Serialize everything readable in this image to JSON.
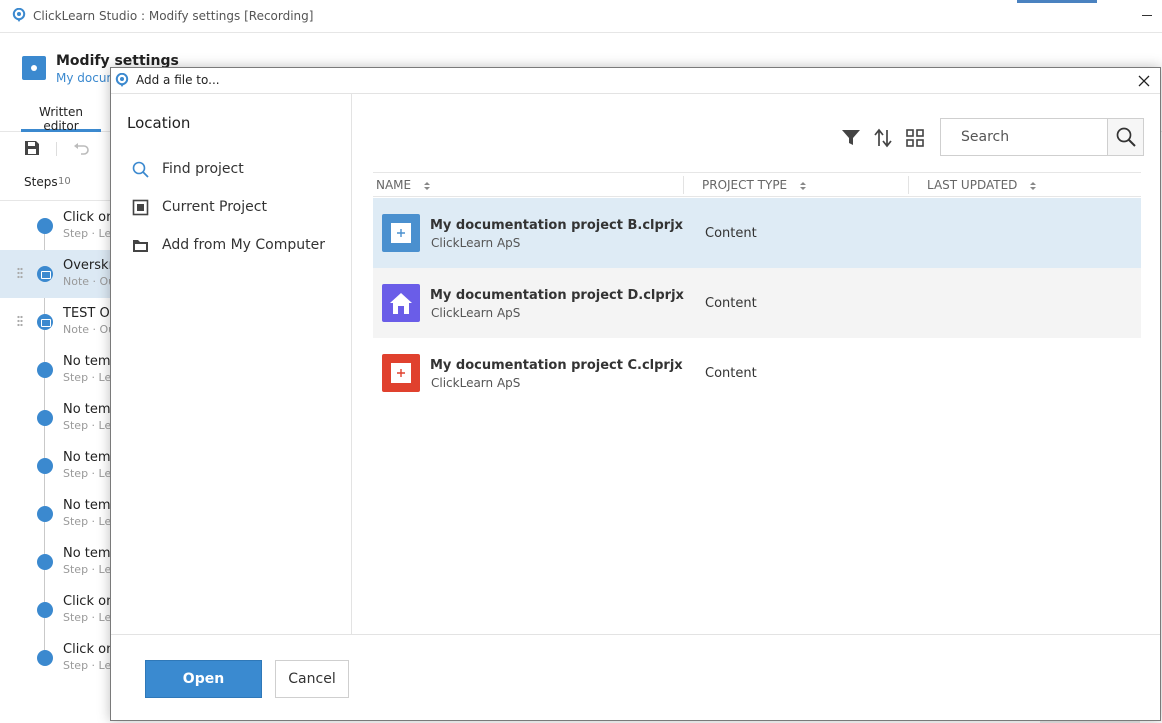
{
  "app": {
    "window_title": "ClickLearn Studio : Modify settings [Recording]",
    "heading": "Modify settings",
    "subheading": "My docum",
    "tab_label": "Written editor",
    "steps_label": "Steps",
    "steps_count": "10",
    "steps": [
      {
        "title": "Click on",
        "meta": "Step · Le",
        "kind": "step",
        "selected": false
      },
      {
        "title": "Overskr",
        "meta": "Note · Ou",
        "kind": "note",
        "selected": true
      },
      {
        "title": "TEST Op",
        "meta": "Note · Ou",
        "kind": "note",
        "selected": false
      },
      {
        "title": "No temp",
        "meta": "Step · Le",
        "kind": "step",
        "selected": false
      },
      {
        "title": "No temp",
        "meta": "Step · Le",
        "kind": "step",
        "selected": false
      },
      {
        "title": "No temp",
        "meta": "Step · Le",
        "kind": "step",
        "selected": false
      },
      {
        "title": "No temp",
        "meta": "Step · Le",
        "kind": "step",
        "selected": false
      },
      {
        "title": "No temp",
        "meta": "Step · Le",
        "kind": "step",
        "selected": false
      },
      {
        "title": "Click on",
        "meta": "Step · Le",
        "kind": "step",
        "selected": false
      },
      {
        "title": "Click on",
        "meta": "Step · Le",
        "kind": "step",
        "selected": false
      }
    ]
  },
  "dialog": {
    "title": "Add a file to...",
    "location_heading": "Location",
    "locations": [
      {
        "label": "Find project",
        "icon": "search-icon",
        "active": true
      },
      {
        "label": "Current Project",
        "icon": "project-icon",
        "active": false
      },
      {
        "label": "Add from My Computer",
        "icon": "folder-icon",
        "active": false
      }
    ],
    "search": {
      "placeholder": "Search",
      "value": ""
    },
    "columns": {
      "name": "NAME",
      "type": "PROJECT TYPE",
      "updated": "LAST UPDATED"
    },
    "rows": [
      {
        "name": "My documentation project B.clprjx",
        "owner": "ClickLearn ApS",
        "type": "Content",
        "last_updated": "",
        "icon": "plus-icon",
        "color": "#4a90cf",
        "selected": true
      },
      {
        "name": "My documentation project D.clprjx",
        "owner": "ClickLearn ApS",
        "type": "Content",
        "last_updated": "",
        "icon": "home-icon",
        "color": "#6a5de8",
        "selected": false
      },
      {
        "name": "My documentation project C.clprjx",
        "owner": "ClickLearn ApS",
        "type": "Content",
        "last_updated": "",
        "icon": "plus-icon",
        "color": "#e0412e",
        "selected": false
      }
    ],
    "buttons": {
      "open": "Open",
      "cancel": "Cancel"
    }
  }
}
